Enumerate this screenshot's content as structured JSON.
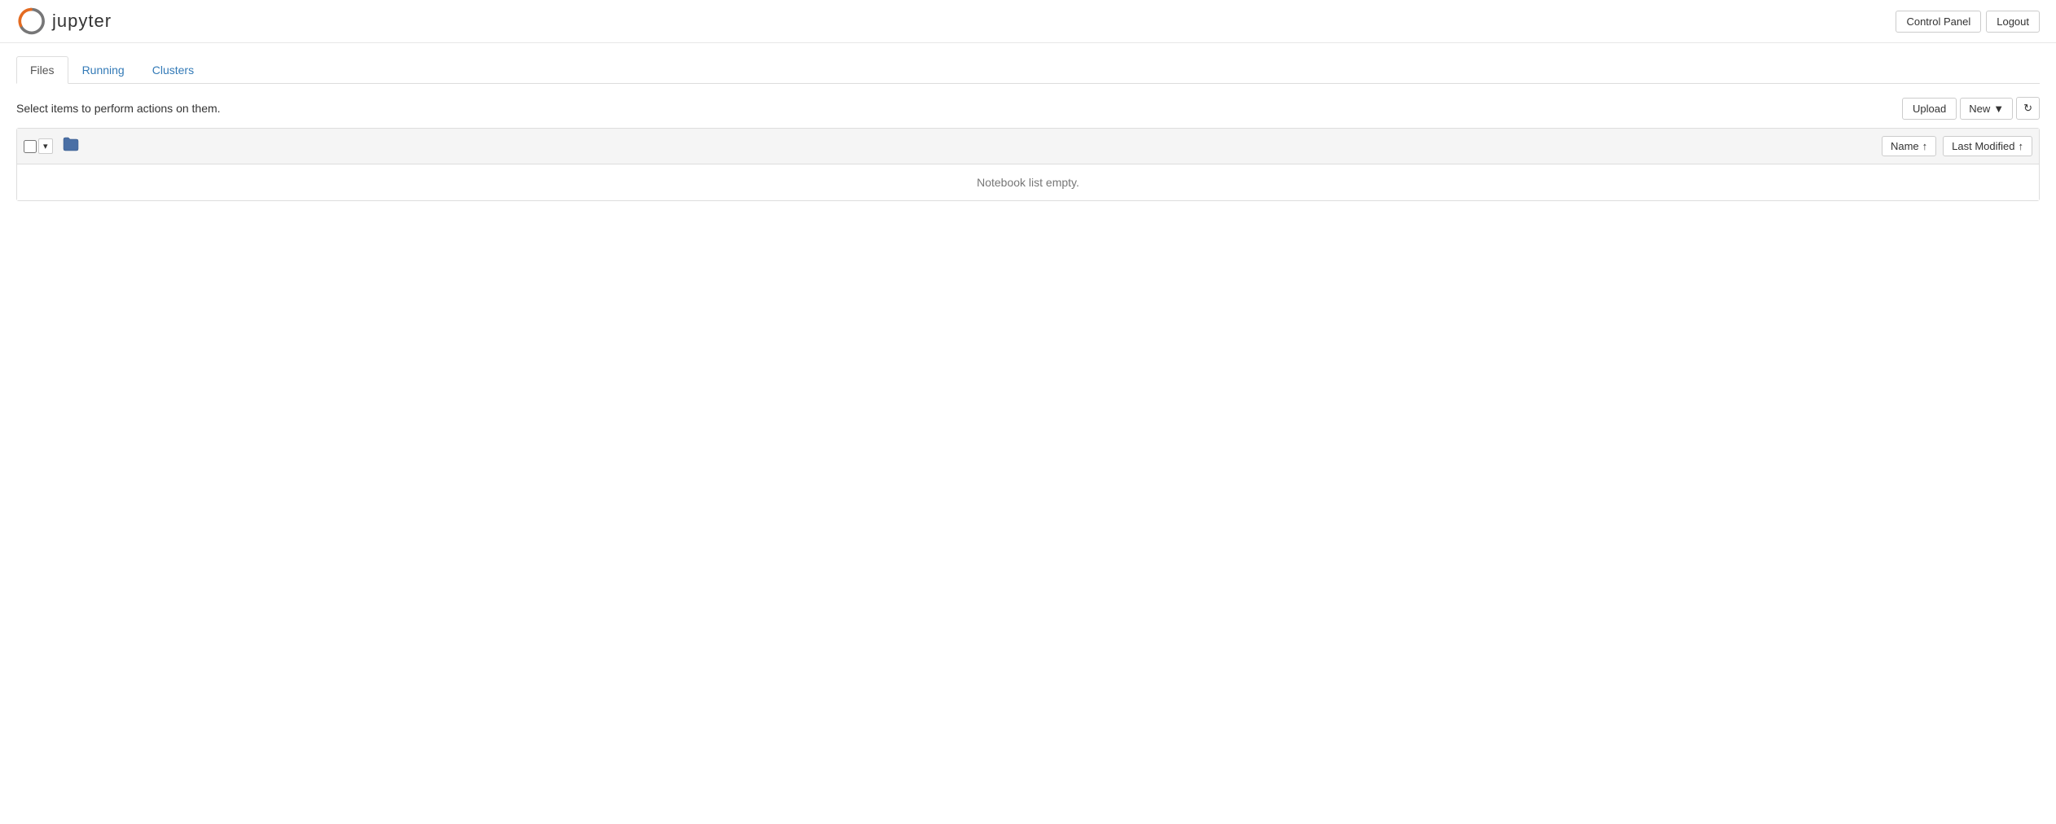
{
  "header": {
    "logo_text": "jupyter",
    "control_panel_label": "Control Panel",
    "logout_label": "Logout"
  },
  "tabs": {
    "items": [
      {
        "label": "Files",
        "active": true
      },
      {
        "label": "Running",
        "active": false
      },
      {
        "label": "Clusters",
        "active": false
      }
    ]
  },
  "toolbar": {
    "select_info": "Select items to perform actions on them.",
    "upload_label": "Upload",
    "new_label": "New",
    "new_dropdown_arrow": "▼",
    "refresh_icon": "↻"
  },
  "file_list": {
    "name_sort_label": "Name",
    "name_sort_arrow": "↑",
    "last_modified_label": "Last Modified",
    "last_modified_arrow": "↑",
    "empty_message": "Notebook list empty.",
    "dropdown_arrow": "▾",
    "folder_icon": "📁"
  }
}
